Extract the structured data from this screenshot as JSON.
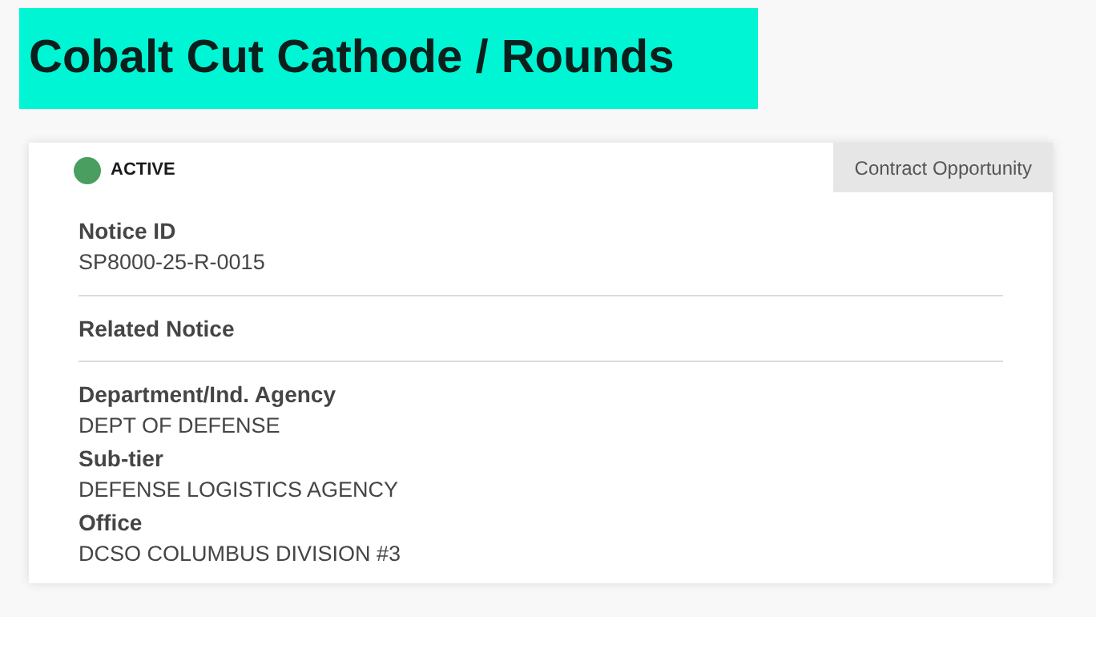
{
  "title": "Cobalt Cut Cathode / Rounds",
  "status": {
    "label": "ACTIVE",
    "active": true
  },
  "type_tag": "Contract Opportunity",
  "sections": [
    {
      "fields": [
        {
          "label": "Notice ID",
          "value": "SP8000-25-R-0015"
        }
      ]
    },
    {
      "fields": [
        {
          "label": "Related Notice"
        }
      ]
    },
    {
      "fields": [
        {
          "label": "Department/Ind. Agency",
          "value": "DEPT OF DEFENSE"
        },
        {
          "label": "Sub-tier",
          "value": "DEFENSE LOGISTICS AGENCY"
        },
        {
          "label": "Office",
          "value": "DCSO COLUMBUS DIVISION #3"
        }
      ]
    }
  ]
}
